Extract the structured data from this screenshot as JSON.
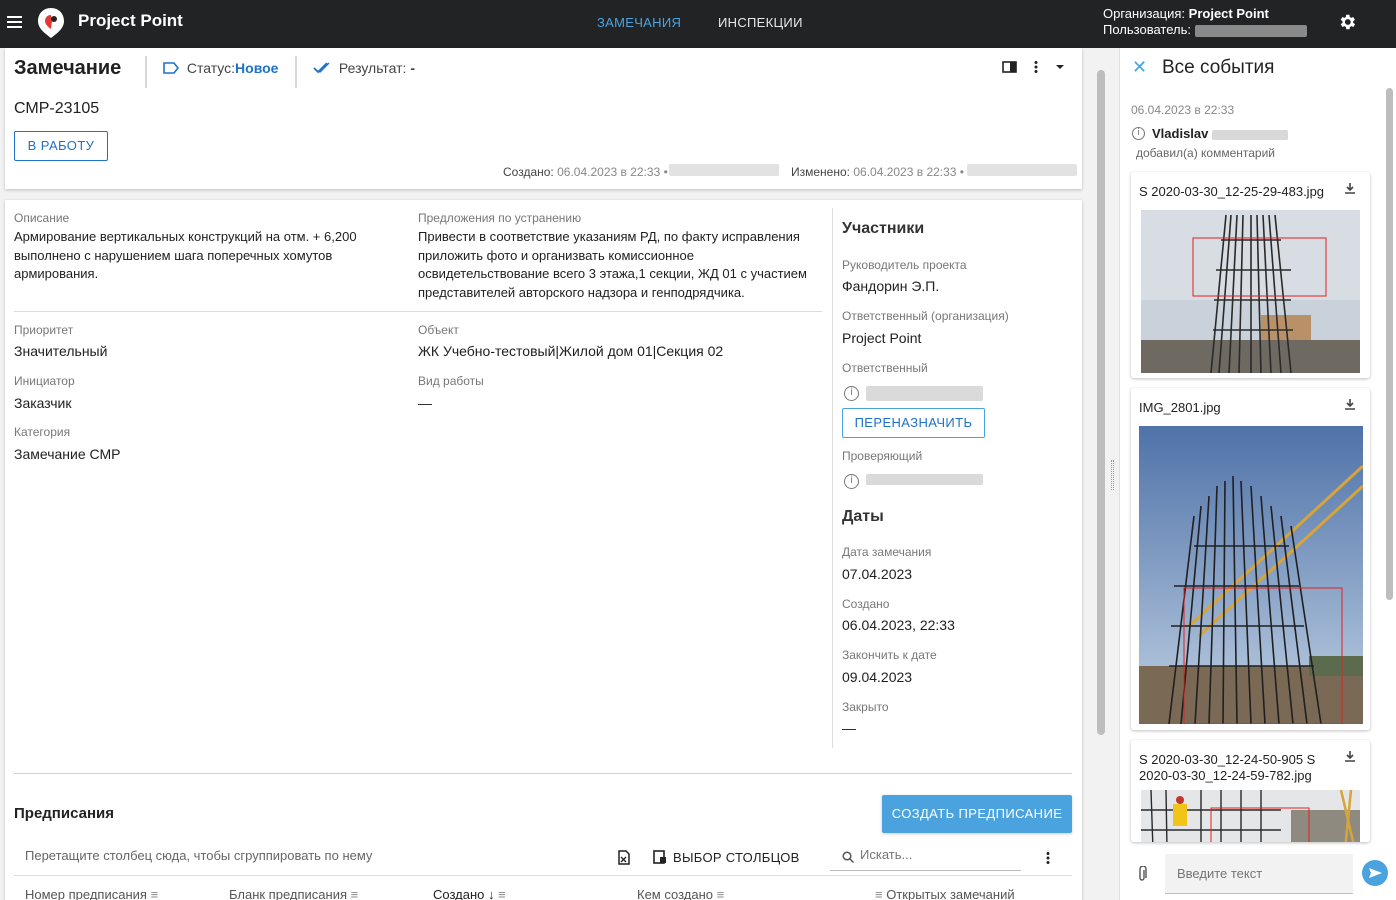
{
  "app": {
    "name": "Project Point"
  },
  "nav": {
    "tab_remarks": "ЗАМЕЧАНИЯ",
    "tab_inspections": "ИНСПЕКЦИИ"
  },
  "account": {
    "org_label": "Организация:",
    "org_value": "Project Point",
    "user_label": "Пользователь:"
  },
  "issue": {
    "title": "Замечание",
    "status_label": "Статус:",
    "status_value": "Новое",
    "result_label": "Результат:",
    "result_value": "-",
    "code": "СМР-23105",
    "to_work_button": "В РАБОТУ",
    "created_label": "Создано:",
    "created_value": "06.04.2023 в 22:33 •",
    "changed_label": "Изменено:",
    "changed_value": "06.04.2023 в 22:33 •"
  },
  "details": {
    "description_label": "Описание",
    "description_text": "Армирование вертикальных конструкций на отм. + 6,200 выполнено с нарушением шага  поперечных хомутов армирования.",
    "proposal_label": "Предложения по устранению",
    "proposal_text": "Привести в соответствие указаниям РД, по факту исправления приложить фото и организвать комиссионное освидетельствование всего 3 этажа,1 секции, ЖД 01  с участием представителей авторского надзора и генподрядчика.",
    "priority_label": "Приоритет",
    "priority_value": "Значительный",
    "object_label": "Объект",
    "object_value": "ЖК Учебно-тестовый|Жилой дом 01|Секция 02",
    "initiator_label": "Инициатор",
    "initiator_value": "Заказчик",
    "work_type_label": "Вид работы",
    "work_type_value": "—",
    "category_label": "Категория",
    "category_value": "Замечание СМР"
  },
  "participants": {
    "title": "Участники",
    "manager_label": "Руководитель проекта",
    "manager_value": "Фандорин Э.П.",
    "resp_org_label": "Ответственный (организация)",
    "resp_org_value": "Project Point",
    "resp_label": "Ответственный",
    "reassign_button": "ПЕРЕНАЗНАЧИТЬ",
    "checker_label": "Проверяющий"
  },
  "dates": {
    "title": "Даты",
    "remark_date_label": "Дата замечания",
    "remark_date_value": "07.04.2023",
    "created_label": "Создано",
    "created_value": "06.04.2023, 22:33",
    "finish_label": "Закончить к дате",
    "finish_value": "09.04.2023",
    "closed_label": "Закрыто",
    "closed_value": "—"
  },
  "prescriptions": {
    "title": "Предписания",
    "create_button": "СОЗДАТЬ ПРЕДПИСАНИЕ",
    "group_hint": "Перетащите столбец сюда, чтобы сгруппировать по нему",
    "columns_button": "ВЫБОР СТОЛБЦОВ",
    "search_placeholder": "Искать...",
    "columns": [
      "Номер предписания",
      "Бланк предписания",
      "Создано",
      "Кем создано",
      "Открытых замечаний"
    ]
  },
  "events": {
    "title": "Все события",
    "date": "06.04.2023 в 22:33",
    "user": "Vladislav",
    "action": "добавил(а) комментарий",
    "attachments": [
      {
        "name": "S 2020-03-30_12-25-29-483.jpg"
      },
      {
        "name": "IMG_2801.jpg"
      },
      {
        "name": "S 2020-03-30_12-24-50-905 S 2020-03-30_12-24-59-782.jpg"
      }
    ],
    "message_placeholder": "Введите текст"
  },
  "colors": {
    "accent": "#4aa3df",
    "link": "#1e72c9",
    "topbar": "#222325"
  }
}
